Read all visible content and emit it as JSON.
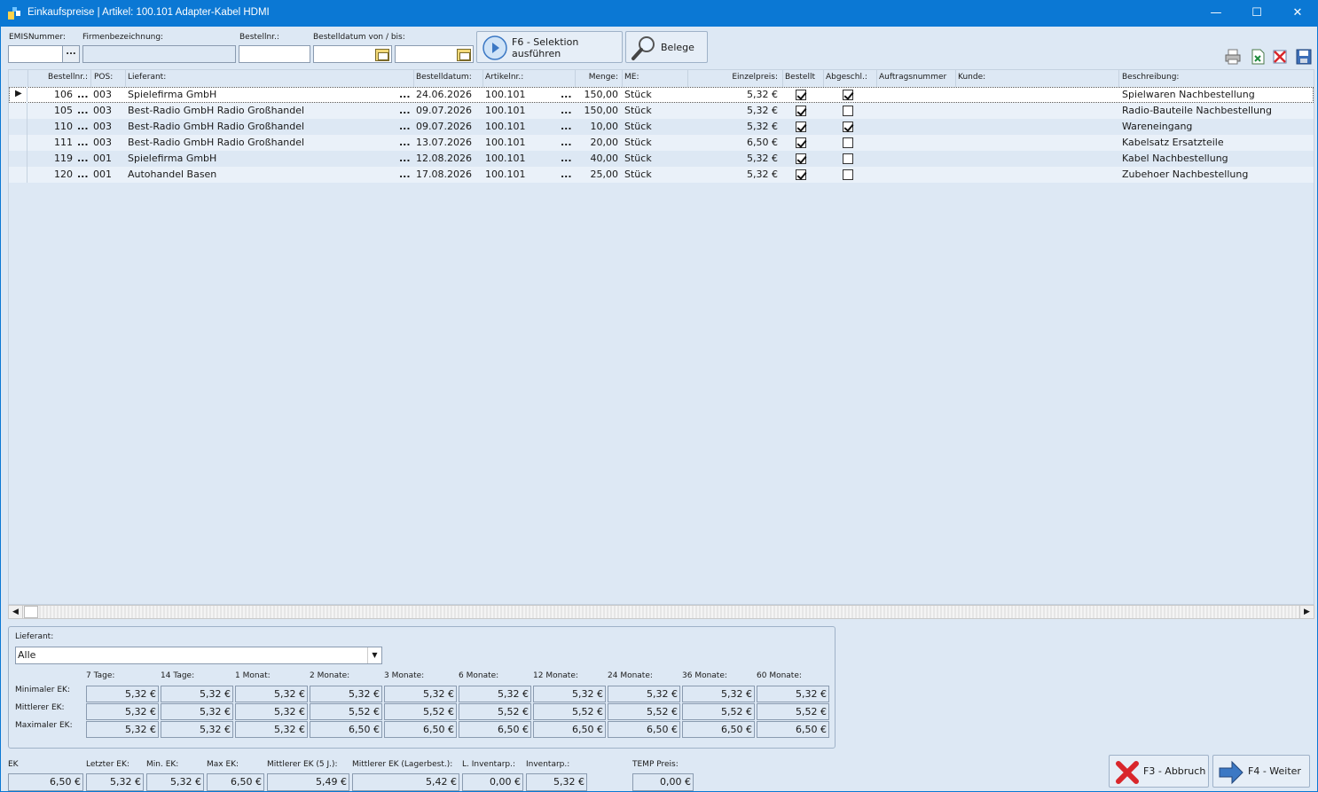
{
  "window": {
    "title": "Einkaufspreise | Artikel: 100.101 Adapter-Kabel HDMI",
    "minimize": "—",
    "maximize": "☐",
    "close": "✕"
  },
  "filters": {
    "emis_label": "EMISNummer:",
    "emis_value": "",
    "emis_button": "...",
    "firma_label": "Firmenbezeichnung:",
    "firma_value": "",
    "bestellnr_label": "Bestellnr.:",
    "bestellnr_value": "",
    "datum_label": "Bestelldatum von / bis:",
    "datum_von": "",
    "datum_bis": ""
  },
  "buttons": {
    "selection": [
      "F6 - Selektion",
      "ausführen"
    ],
    "belege": "Belege",
    "cancel": "F3 - Abbruch",
    "next": "F4 - Weiter"
  },
  "grid": {
    "headers": {
      "bestellnr": "Bestellnr.:",
      "pos": "POS:",
      "lieferant": "Lieferant:",
      "bestelldatum": "Bestelldatum:",
      "artikelnr": "Artikelnr.:",
      "menge": "Menge:",
      "me": "ME:",
      "einzelpreis": "Einzelpreis:",
      "bestellt": "Bestellt",
      "abgeschl": "Abgeschl.:",
      "auftragsnummer": "Auftragsnummer",
      "kunde": "Kunde:",
      "beschreibung": "Beschreibung:"
    },
    "ellipsis": "...",
    "rows": [
      {
        "bestellnr": "106",
        "pos": "003",
        "lieferant": "Spielefirma GmbH",
        "datum": "24.06.2026",
        "artikel": "100.101",
        "menge": "150,00",
        "me": "Stück",
        "preis": "5,32 €",
        "bestellt": true,
        "abgeschl": true,
        "auftrag": "",
        "kunde": "",
        "beschreibung": "Spielwaren Nachbestellung"
      },
      {
        "bestellnr": "105",
        "pos": "003",
        "lieferant": "Best-Radio GmbH Radio Großhandel",
        "datum": "09.07.2026",
        "artikel": "100.101",
        "menge": "150,00",
        "me": "Stück",
        "preis": "5,32 €",
        "bestellt": true,
        "abgeschl": false,
        "auftrag": "",
        "kunde": "",
        "beschreibung": "Radio-Bauteile Nachbestellung"
      },
      {
        "bestellnr": "110",
        "pos": "003",
        "lieferant": "Best-Radio GmbH Radio Großhandel",
        "datum": "09.07.2026",
        "artikel": "100.101",
        "menge": "10,00",
        "me": "Stück",
        "preis": "5,32 €",
        "bestellt": true,
        "abgeschl": true,
        "auftrag": "",
        "kunde": "",
        "beschreibung": "Wareneingang"
      },
      {
        "bestellnr": "111",
        "pos": "003",
        "lieferant": "Best-Radio GmbH Radio Großhandel",
        "datum": "13.07.2026",
        "artikel": "100.101",
        "menge": "20,00",
        "me": "Stück",
        "preis": "6,50 €",
        "bestellt": true,
        "abgeschl": false,
        "auftrag": "",
        "kunde": "",
        "beschreibung": "Kabelsatz Ersatzteile"
      },
      {
        "bestellnr": "119",
        "pos": "001",
        "lieferant": "Spielefirma GmbH",
        "datum": "12.08.2026",
        "artikel": "100.101",
        "menge": "40,00",
        "me": "Stück",
        "preis": "5,32 €",
        "bestellt": true,
        "abgeschl": false,
        "auftrag": "",
        "kunde": "",
        "beschreibung": "Kabel Nachbestellung"
      },
      {
        "bestellnr": "120",
        "pos": "001",
        "lieferant": "Autohandel Basen",
        "datum": "17.08.2026",
        "artikel": "100.101",
        "menge": "25,00",
        "me": "Stück",
        "preis": "5,32 €",
        "bestellt": true,
        "abgeschl": false,
        "auftrag": "",
        "kunde": "",
        "beschreibung": "Zubehoer Nachbestellung"
      }
    ]
  },
  "stats": {
    "lieferant_label": "Lieferant:",
    "lieferant_value": "Alle",
    "periods": [
      "7 Tage:",
      "14 Tage:",
      "1 Monat:",
      "2 Monate:",
      "3 Monate:",
      "6 Monate:",
      "12 Monate:",
      "24 Monate:",
      "36 Monate:",
      "60 Monate:"
    ],
    "rows": [
      {
        "label": "Minimaler EK:",
        "values": [
          "5,32 €",
          "5,32 €",
          "5,32 €",
          "5,32 €",
          "5,32 €",
          "5,32 €",
          "5,32 €",
          "5,32 €",
          "5,32 €",
          "5,32 €"
        ]
      },
      {
        "label": "Mittlerer EK:",
        "values": [
          "5,32 €",
          "5,32 €",
          "5,32 €",
          "5,52 €",
          "5,52 €",
          "5,52 €",
          "5,52 €",
          "5,52 €",
          "5,52 €",
          "5,52 €"
        ]
      },
      {
        "label": "Maximaler EK:",
        "values": [
          "5,32 €",
          "5,32 €",
          "5,32 €",
          "6,50 €",
          "6,50 €",
          "6,50 €",
          "6,50 €",
          "6,50 €",
          "6,50 €",
          "6,50 €"
        ]
      }
    ]
  },
  "bottom": [
    {
      "label": "EK",
      "value": "6,50 €"
    },
    {
      "label": "Letzter EK:",
      "value": "5,32 €"
    },
    {
      "label": "Min. EK:",
      "value": "5,32 €"
    },
    {
      "label": "Max EK:",
      "value": "6,50 €"
    },
    {
      "label": "Mittlerer EK (5 J.):",
      "value": "5,49 €"
    },
    {
      "label": "Mittlerer EK (Lagerbest.):",
      "value": "5,42 €"
    },
    {
      "label": "L. Inventarp.:",
      "value": "0,00 €"
    },
    {
      "label": "Inventarp.:",
      "value": "5,32 €"
    },
    {
      "label": "TEMP Preis:",
      "value": "0,00 €"
    }
  ],
  "toolbar_icons": [
    "printer-icon",
    "export-excel-icon",
    "delete-icon",
    "save-icon"
  ],
  "colors": {
    "titlebar": "#0b78d4",
    "background": "#dde8f4",
    "cancel_red": "#d9262b",
    "next_blue": "#3b78c4"
  }
}
